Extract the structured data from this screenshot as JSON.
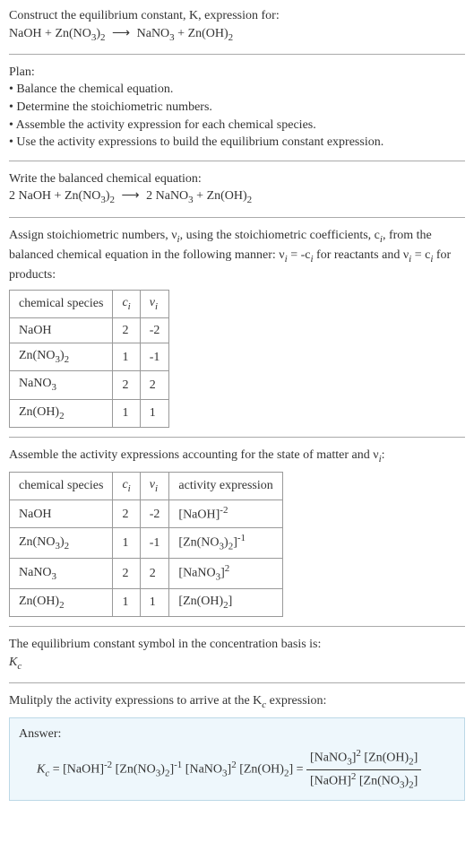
{
  "q_prompt": "Construct the equilibrium constant, K, expression for:",
  "eq_unbalanced_1": "NaOH + Zn(NO",
  "eq_unbalanced_2": ")",
  "arrow": "⟶",
  "eq_unbalanced_3": "NaNO",
  "eq_unbalanced_4": " + Zn(OH)",
  "plan_head": "Plan:",
  "plan_1": "• Balance the chemical equation.",
  "plan_2": "• Determine the stoichiometric numbers.",
  "plan_3": "• Assemble the activity expression for each chemical species.",
  "plan_4": "• Use the activity expressions to build the equilibrium constant expression.",
  "balanced_head": "Write the balanced chemical equation:",
  "bal_1": "2 NaOH + Zn(NO",
  "bal_2": ")",
  "bal_3": "2 NaNO",
  "bal_4": " + Zn(OH)",
  "stoich_text_1": "Assign stoichiometric numbers, ν",
  "stoich_text_2": ", using the stoichiometric coefficients, c",
  "stoich_text_3": ", from the balanced chemical equation in the following manner: ν",
  "stoich_text_4": " = -c",
  "stoich_text_5": " for reactants and ν",
  "stoich_text_6": " = c",
  "stoich_text_7": " for products:",
  "th_species": "chemical species",
  "th_ci": "c",
  "th_vi": "ν",
  "tbl1": [
    {
      "species": "NaOH",
      "c": "2",
      "v": "-2"
    },
    {
      "species_1": "Zn(NO",
      "species_2": ")",
      "c": "1",
      "v": "-1"
    },
    {
      "species_1": "NaNO",
      "c": "2",
      "v": "2"
    },
    {
      "species_1": "Zn(OH)",
      "c": "1",
      "v": "1"
    }
  ],
  "assemble_text_1": "Assemble the activity expressions accounting for the state of matter and ν",
  "assemble_text_2": ":",
  "th_activity": "activity expression",
  "tbl2": [
    {
      "species": "NaOH",
      "c": "2",
      "v": "-2",
      "act_base": "[NaOH]",
      "act_exp": "-2"
    },
    {
      "species_1": "Zn(NO",
      "species_2": ")",
      "c": "1",
      "v": "-1",
      "act_base_1": "[Zn(NO",
      "act_base_2": ")",
      "act_base_3": "]",
      "act_exp": "-1"
    },
    {
      "species_1": "NaNO",
      "c": "2",
      "v": "2",
      "act_base_1": "[NaNO",
      "act_base_2": "]",
      "act_exp": "2"
    },
    {
      "species_1": "Zn(OH)",
      "c": "1",
      "v": "1",
      "act_base_1": "[Zn(OH)",
      "act_base_2": "]"
    }
  ],
  "ksymbol_text": "The equilibrium constant symbol in the concentration basis is:",
  "ksymbol": "K",
  "multiply_text_1": "Mulitply the activity expressions to arrive at the K",
  "multiply_text_2": " expression:",
  "answer_label": "Answer:",
  "ans_lhs": "K",
  "ans_eq": " = [NaOH]",
  "ans_e1": "-2",
  "ans_m2_1": " [Zn(NO",
  "ans_m2_2": ")",
  "ans_m2_3": "]",
  "ans_e2": "-1",
  "ans_m3_1": " [NaNO",
  "ans_m3_2": "]",
  "ans_e3": "2",
  "ans_m4_1": " [Zn(OH)",
  "ans_m4_2": "] = ",
  "num_1": "[NaNO",
  "num_2": "]",
  "num_e1": "2",
  "num_3": " [Zn(OH)",
  "num_4": "]",
  "den_1": "[NaOH]",
  "den_e1": "2",
  "den_2": " [Zn(NO",
  "den_3": ")",
  "den_4": "]",
  "three": "3",
  "two": "2",
  "i": "i",
  "c": "c"
}
